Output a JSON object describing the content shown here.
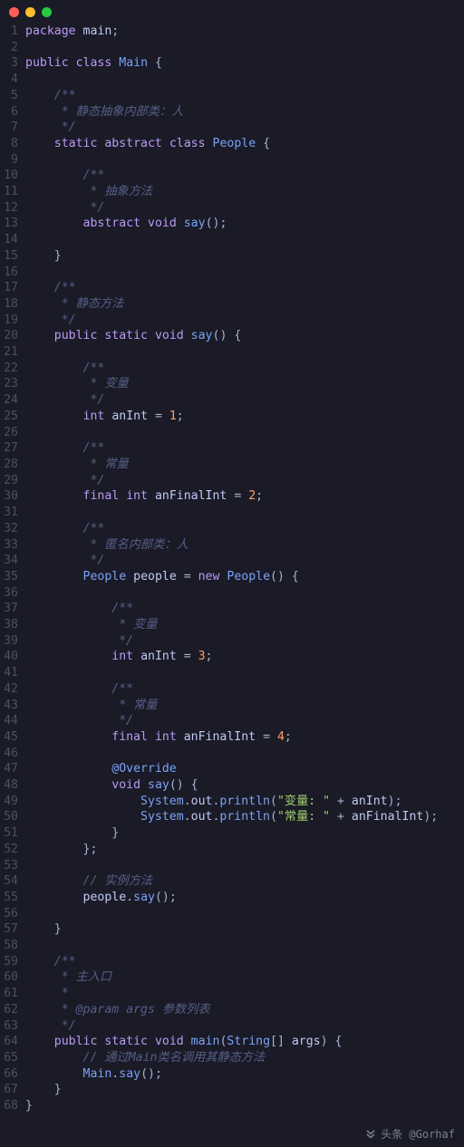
{
  "titlebar": {
    "dots": [
      "red",
      "yellow",
      "green"
    ]
  },
  "footer": {
    "icon": "double-chevron-down-icon",
    "handle": "头条 @Gorhaf"
  },
  "lines": [
    {
      "n": 1,
      "seg": [
        [
          "kw",
          "package"
        ],
        [
          "pn",
          " "
        ],
        [
          "var",
          "main"
        ],
        [
          "pn",
          ";"
        ]
      ]
    },
    {
      "n": 2,
      "seg": []
    },
    {
      "n": 3,
      "seg": [
        [
          "kw",
          "public"
        ],
        [
          "pn",
          " "
        ],
        [
          "kw",
          "class"
        ],
        [
          "pn",
          " "
        ],
        [
          "cls",
          "Main"
        ],
        [
          "pn",
          " {"
        ]
      ]
    },
    {
      "n": 4,
      "seg": []
    },
    {
      "n": 5,
      "seg": [
        [
          "pn",
          "    "
        ],
        [
          "cmt",
          "/**"
        ]
      ]
    },
    {
      "n": 6,
      "seg": [
        [
          "pn",
          "    "
        ],
        [
          "cmt",
          " * 静态抽象内部类：人"
        ]
      ]
    },
    {
      "n": 7,
      "seg": [
        [
          "pn",
          "    "
        ],
        [
          "cmt",
          " */"
        ]
      ]
    },
    {
      "n": 8,
      "seg": [
        [
          "pn",
          "    "
        ],
        [
          "kw",
          "static"
        ],
        [
          "pn",
          " "
        ],
        [
          "kw",
          "abstract"
        ],
        [
          "pn",
          " "
        ],
        [
          "kw",
          "class"
        ],
        [
          "pn",
          " "
        ],
        [
          "cls",
          "People"
        ],
        [
          "pn",
          " {"
        ]
      ]
    },
    {
      "n": 9,
      "seg": []
    },
    {
      "n": 10,
      "seg": [
        [
          "pn",
          "        "
        ],
        [
          "cmt",
          "/**"
        ]
      ]
    },
    {
      "n": 11,
      "seg": [
        [
          "pn",
          "        "
        ],
        [
          "cmt",
          " * 抽象方法"
        ]
      ]
    },
    {
      "n": 12,
      "seg": [
        [
          "pn",
          "        "
        ],
        [
          "cmt",
          " */"
        ]
      ]
    },
    {
      "n": 13,
      "seg": [
        [
          "pn",
          "        "
        ],
        [
          "kw",
          "abstract"
        ],
        [
          "pn",
          " "
        ],
        [
          "kw",
          "void"
        ],
        [
          "pn",
          " "
        ],
        [
          "mth",
          "say"
        ],
        [
          "pn",
          "();"
        ]
      ]
    },
    {
      "n": 14,
      "seg": []
    },
    {
      "n": 15,
      "seg": [
        [
          "pn",
          "    }"
        ]
      ]
    },
    {
      "n": 16,
      "seg": []
    },
    {
      "n": 17,
      "seg": [
        [
          "pn",
          "    "
        ],
        [
          "cmt",
          "/**"
        ]
      ]
    },
    {
      "n": 18,
      "seg": [
        [
          "pn",
          "    "
        ],
        [
          "cmt",
          " * 静态方法"
        ]
      ]
    },
    {
      "n": 19,
      "seg": [
        [
          "pn",
          "    "
        ],
        [
          "cmt",
          " */"
        ]
      ]
    },
    {
      "n": 20,
      "seg": [
        [
          "pn",
          "    "
        ],
        [
          "kw",
          "public"
        ],
        [
          "pn",
          " "
        ],
        [
          "kw",
          "static"
        ],
        [
          "pn",
          " "
        ],
        [
          "kw",
          "void"
        ],
        [
          "pn",
          " "
        ],
        [
          "mth",
          "say"
        ],
        [
          "pn",
          "() {"
        ]
      ]
    },
    {
      "n": 21,
      "seg": []
    },
    {
      "n": 22,
      "seg": [
        [
          "pn",
          "        "
        ],
        [
          "cmt",
          "/**"
        ]
      ]
    },
    {
      "n": 23,
      "seg": [
        [
          "pn",
          "        "
        ],
        [
          "cmt",
          " * 变量"
        ]
      ]
    },
    {
      "n": 24,
      "seg": [
        [
          "pn",
          "        "
        ],
        [
          "cmt",
          " */"
        ]
      ]
    },
    {
      "n": 25,
      "seg": [
        [
          "pn",
          "        "
        ],
        [
          "kw",
          "int"
        ],
        [
          "pn",
          " "
        ],
        [
          "var",
          "anInt"
        ],
        [
          "pn",
          " = "
        ],
        [
          "num",
          "1"
        ],
        [
          "pn",
          ";"
        ]
      ]
    },
    {
      "n": 26,
      "seg": []
    },
    {
      "n": 27,
      "seg": [
        [
          "pn",
          "        "
        ],
        [
          "cmt",
          "/**"
        ]
      ]
    },
    {
      "n": 28,
      "seg": [
        [
          "pn",
          "        "
        ],
        [
          "cmt",
          " * 常量"
        ]
      ]
    },
    {
      "n": 29,
      "seg": [
        [
          "pn",
          "        "
        ],
        [
          "cmt",
          " */"
        ]
      ]
    },
    {
      "n": 30,
      "seg": [
        [
          "pn",
          "        "
        ],
        [
          "kw",
          "final"
        ],
        [
          "pn",
          " "
        ],
        [
          "kw",
          "int"
        ],
        [
          "pn",
          " "
        ],
        [
          "var",
          "anFinalInt"
        ],
        [
          "pn",
          " = "
        ],
        [
          "num",
          "2"
        ],
        [
          "pn",
          ";"
        ]
      ]
    },
    {
      "n": 31,
      "seg": []
    },
    {
      "n": 32,
      "seg": [
        [
          "pn",
          "        "
        ],
        [
          "cmt",
          "/**"
        ]
      ]
    },
    {
      "n": 33,
      "seg": [
        [
          "pn",
          "        "
        ],
        [
          "cmt",
          " * 匿名内部类：人"
        ]
      ]
    },
    {
      "n": 34,
      "seg": [
        [
          "pn",
          "        "
        ],
        [
          "cmt",
          " */"
        ]
      ]
    },
    {
      "n": 35,
      "seg": [
        [
          "pn",
          "        "
        ],
        [
          "cls",
          "People"
        ],
        [
          "pn",
          " "
        ],
        [
          "var",
          "people"
        ],
        [
          "pn",
          " = "
        ],
        [
          "kw",
          "new"
        ],
        [
          "pn",
          " "
        ],
        [
          "cls",
          "People"
        ],
        [
          "pn",
          "() {"
        ]
      ]
    },
    {
      "n": 36,
      "seg": []
    },
    {
      "n": 37,
      "seg": [
        [
          "pn",
          "            "
        ],
        [
          "cmt",
          "/**"
        ]
      ]
    },
    {
      "n": 38,
      "seg": [
        [
          "pn",
          "            "
        ],
        [
          "cmt",
          " * 变量"
        ]
      ]
    },
    {
      "n": 39,
      "seg": [
        [
          "pn",
          "            "
        ],
        [
          "cmt",
          " */"
        ]
      ]
    },
    {
      "n": 40,
      "seg": [
        [
          "pn",
          "            "
        ],
        [
          "kw",
          "int"
        ],
        [
          "pn",
          " "
        ],
        [
          "var",
          "anInt"
        ],
        [
          "pn",
          " = "
        ],
        [
          "num",
          "3"
        ],
        [
          "pn",
          ";"
        ]
      ]
    },
    {
      "n": 41,
      "seg": []
    },
    {
      "n": 42,
      "seg": [
        [
          "pn",
          "            "
        ],
        [
          "cmt",
          "/**"
        ]
      ]
    },
    {
      "n": 43,
      "seg": [
        [
          "pn",
          "            "
        ],
        [
          "cmt",
          " * 常量"
        ]
      ]
    },
    {
      "n": 44,
      "seg": [
        [
          "pn",
          "            "
        ],
        [
          "cmt",
          " */"
        ]
      ]
    },
    {
      "n": 45,
      "seg": [
        [
          "pn",
          "            "
        ],
        [
          "kw",
          "final"
        ],
        [
          "pn",
          " "
        ],
        [
          "kw",
          "int"
        ],
        [
          "pn",
          " "
        ],
        [
          "var",
          "anFinalInt"
        ],
        [
          "pn",
          " = "
        ],
        [
          "num",
          "4"
        ],
        [
          "pn",
          ";"
        ]
      ]
    },
    {
      "n": 46,
      "seg": []
    },
    {
      "n": 47,
      "seg": [
        [
          "pn",
          "            "
        ],
        [
          "ann",
          "@Override"
        ]
      ]
    },
    {
      "n": 48,
      "seg": [
        [
          "pn",
          "            "
        ],
        [
          "kw",
          "void"
        ],
        [
          "pn",
          " "
        ],
        [
          "mth",
          "say"
        ],
        [
          "pn",
          "() {"
        ]
      ]
    },
    {
      "n": 49,
      "seg": [
        [
          "pn",
          "                "
        ],
        [
          "typ",
          "System"
        ],
        [
          "pn",
          "."
        ],
        [
          "var",
          "out"
        ],
        [
          "pn",
          "."
        ],
        [
          "mth",
          "println"
        ],
        [
          "pn",
          "("
        ],
        [
          "str",
          "\"变量: \""
        ],
        [
          "pn",
          " + "
        ],
        [
          "var",
          "anInt"
        ],
        [
          "pn",
          ");"
        ]
      ]
    },
    {
      "n": 50,
      "seg": [
        [
          "pn",
          "                "
        ],
        [
          "typ",
          "System"
        ],
        [
          "pn",
          "."
        ],
        [
          "var",
          "out"
        ],
        [
          "pn",
          "."
        ],
        [
          "mth",
          "println"
        ],
        [
          "pn",
          "("
        ],
        [
          "str",
          "\"常量: \""
        ],
        [
          "pn",
          " + "
        ],
        [
          "var",
          "anFinalInt"
        ],
        [
          "pn",
          ");"
        ]
      ]
    },
    {
      "n": 51,
      "seg": [
        [
          "pn",
          "            }"
        ]
      ]
    },
    {
      "n": 52,
      "seg": [
        [
          "pn",
          "        };"
        ]
      ]
    },
    {
      "n": 53,
      "seg": []
    },
    {
      "n": 54,
      "seg": [
        [
          "pn",
          "        "
        ],
        [
          "cmt",
          "// 实例方法"
        ]
      ]
    },
    {
      "n": 55,
      "seg": [
        [
          "pn",
          "        "
        ],
        [
          "var",
          "people"
        ],
        [
          "pn",
          "."
        ],
        [
          "mth",
          "say"
        ],
        [
          "pn",
          "();"
        ]
      ]
    },
    {
      "n": 56,
      "seg": []
    },
    {
      "n": 57,
      "seg": [
        [
          "pn",
          "    }"
        ]
      ]
    },
    {
      "n": 58,
      "seg": []
    },
    {
      "n": 59,
      "seg": [
        [
          "pn",
          "    "
        ],
        [
          "cmt",
          "/**"
        ]
      ]
    },
    {
      "n": 60,
      "seg": [
        [
          "pn",
          "    "
        ],
        [
          "cmt",
          " * 主入口"
        ]
      ]
    },
    {
      "n": 61,
      "seg": [
        [
          "pn",
          "    "
        ],
        [
          "cmt",
          " *"
        ]
      ]
    },
    {
      "n": 62,
      "seg": [
        [
          "pn",
          "    "
        ],
        [
          "cmt",
          " * @param args 参数列表"
        ]
      ]
    },
    {
      "n": 63,
      "seg": [
        [
          "pn",
          "    "
        ],
        [
          "cmt",
          " */"
        ]
      ]
    },
    {
      "n": 64,
      "seg": [
        [
          "pn",
          "    "
        ],
        [
          "kw",
          "public"
        ],
        [
          "pn",
          " "
        ],
        [
          "kw",
          "static"
        ],
        [
          "pn",
          " "
        ],
        [
          "kw",
          "void"
        ],
        [
          "pn",
          " "
        ],
        [
          "mth",
          "main"
        ],
        [
          "pn",
          "("
        ],
        [
          "typ",
          "String"
        ],
        [
          "pn",
          "[] "
        ],
        [
          "var",
          "args"
        ],
        [
          "pn",
          ") {"
        ]
      ]
    },
    {
      "n": 65,
      "seg": [
        [
          "pn",
          "        "
        ],
        [
          "cmt",
          "// 通过Main类名调用其静态方法"
        ]
      ]
    },
    {
      "n": 66,
      "seg": [
        [
          "pn",
          "        "
        ],
        [
          "cls",
          "Main"
        ],
        [
          "pn",
          "."
        ],
        [
          "mth",
          "say"
        ],
        [
          "pn",
          "();"
        ]
      ]
    },
    {
      "n": 67,
      "seg": [
        [
          "pn",
          "    }"
        ]
      ]
    },
    {
      "n": 68,
      "seg": [
        [
          "pn",
          "}"
        ]
      ]
    }
  ]
}
